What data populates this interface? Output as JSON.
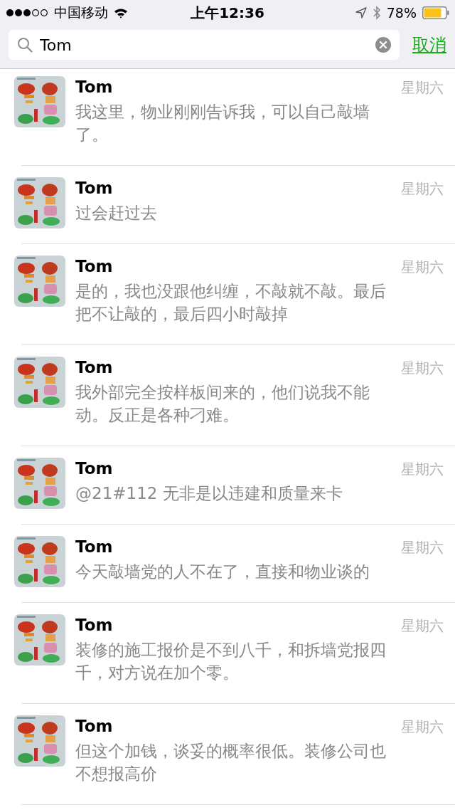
{
  "status_bar": {
    "carrier": "中国移动",
    "time": "上午12:36",
    "battery": "78%"
  },
  "search": {
    "value": "Tom",
    "cancel": "取消"
  },
  "results": [
    {
      "name": "Tom",
      "time": "星期六",
      "message": "我这里，物业刚刚告诉我，可以自己敲墙了。"
    },
    {
      "name": "Tom",
      "time": "星期六",
      "message": "过会赶过去"
    },
    {
      "name": "Tom",
      "time": "星期六",
      "message": "是的，我也没跟他纠缠，不敲就不敲。最后把不让敲的，最后四小时敲掉"
    },
    {
      "name": "Tom",
      "time": "星期六",
      "message": "我外部完全按样板间来的，他们说我不能动。反正是各种刁难。"
    },
    {
      "name": "Tom",
      "time": "星期六",
      "message": "@21#112 无非是以违建和质量来卡"
    },
    {
      "name": "Tom",
      "time": "星期六",
      "message": "今天敲墙党的人不在了，直接和物业谈的"
    },
    {
      "name": "Tom",
      "time": "星期六",
      "message": "装修的施工报价是不到八千，和拆墙党报四千，对方说在加个零。"
    },
    {
      "name": "Tom",
      "time": "星期六",
      "message": "但这个加钱，谈妥的概率很低。装修公司也不想报高价"
    }
  ]
}
